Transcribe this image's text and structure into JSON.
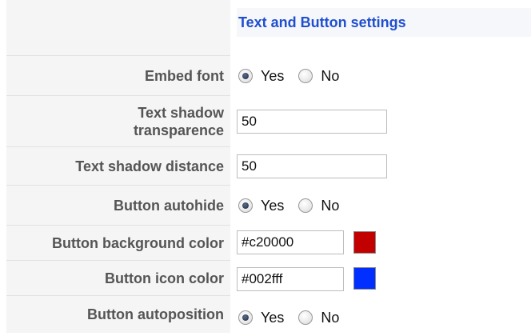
{
  "section_title": "Text and Button settings",
  "fields": {
    "embed_font": {
      "label": "Embed font",
      "options": [
        "Yes",
        "No"
      ],
      "selected": "Yes"
    },
    "text_shadow_transparence": {
      "label_line1": "Text shadow",
      "label_line2": "transparence",
      "value": "50"
    },
    "text_shadow_distance": {
      "label": "Text shadow distance",
      "value": "50"
    },
    "button_autohide": {
      "label": "Button autohide",
      "options": [
        "Yes",
        "No"
      ],
      "selected": "Yes"
    },
    "button_background_color": {
      "label": "Button background color",
      "value": "#c20000",
      "swatch": "#c20000"
    },
    "button_icon_color": {
      "label": "Button icon color",
      "value": "#002fff",
      "swatch": "#002fff"
    },
    "button_autoposition": {
      "label": "Button autoposition",
      "options": [
        "Yes",
        "No"
      ],
      "selected": "Yes"
    }
  }
}
